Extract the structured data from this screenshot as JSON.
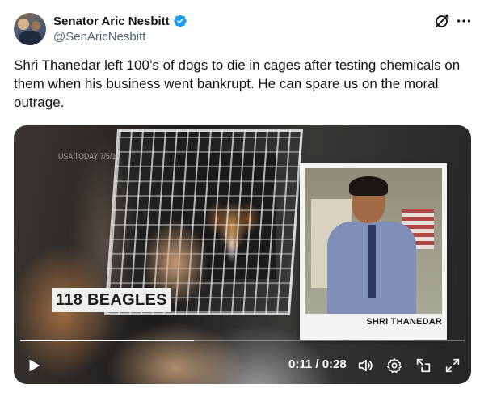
{
  "author": {
    "display_name": "Senator Aric Nesbitt",
    "handle": "@SenAricNesbitt",
    "verified": true
  },
  "icons": {
    "verified": "verified-badge-icon",
    "grok": "grok-icon",
    "more": "more-icon"
  },
  "tweet": {
    "text": "Shri Thanedar left 100’s of dogs to die in cages after testing chemicals on them when his business went bankrupt. He can spare us on the moral outrage."
  },
  "video": {
    "watermark": "USA TODAY 7/5/10",
    "lower_third": "118 BEAGLES",
    "inset_caption": "SHRI THANEDAR",
    "time_display": "0:11 / 0:28",
    "progress_fraction": 0.39,
    "controls": [
      "play-icon",
      "volume-icon",
      "settings-icon",
      "pip-icon",
      "fullscreen-icon"
    ]
  },
  "colors": {
    "verified_blue": "#1d9bf0",
    "text_primary": "#0f1419",
    "text_secondary": "#536471"
  }
}
